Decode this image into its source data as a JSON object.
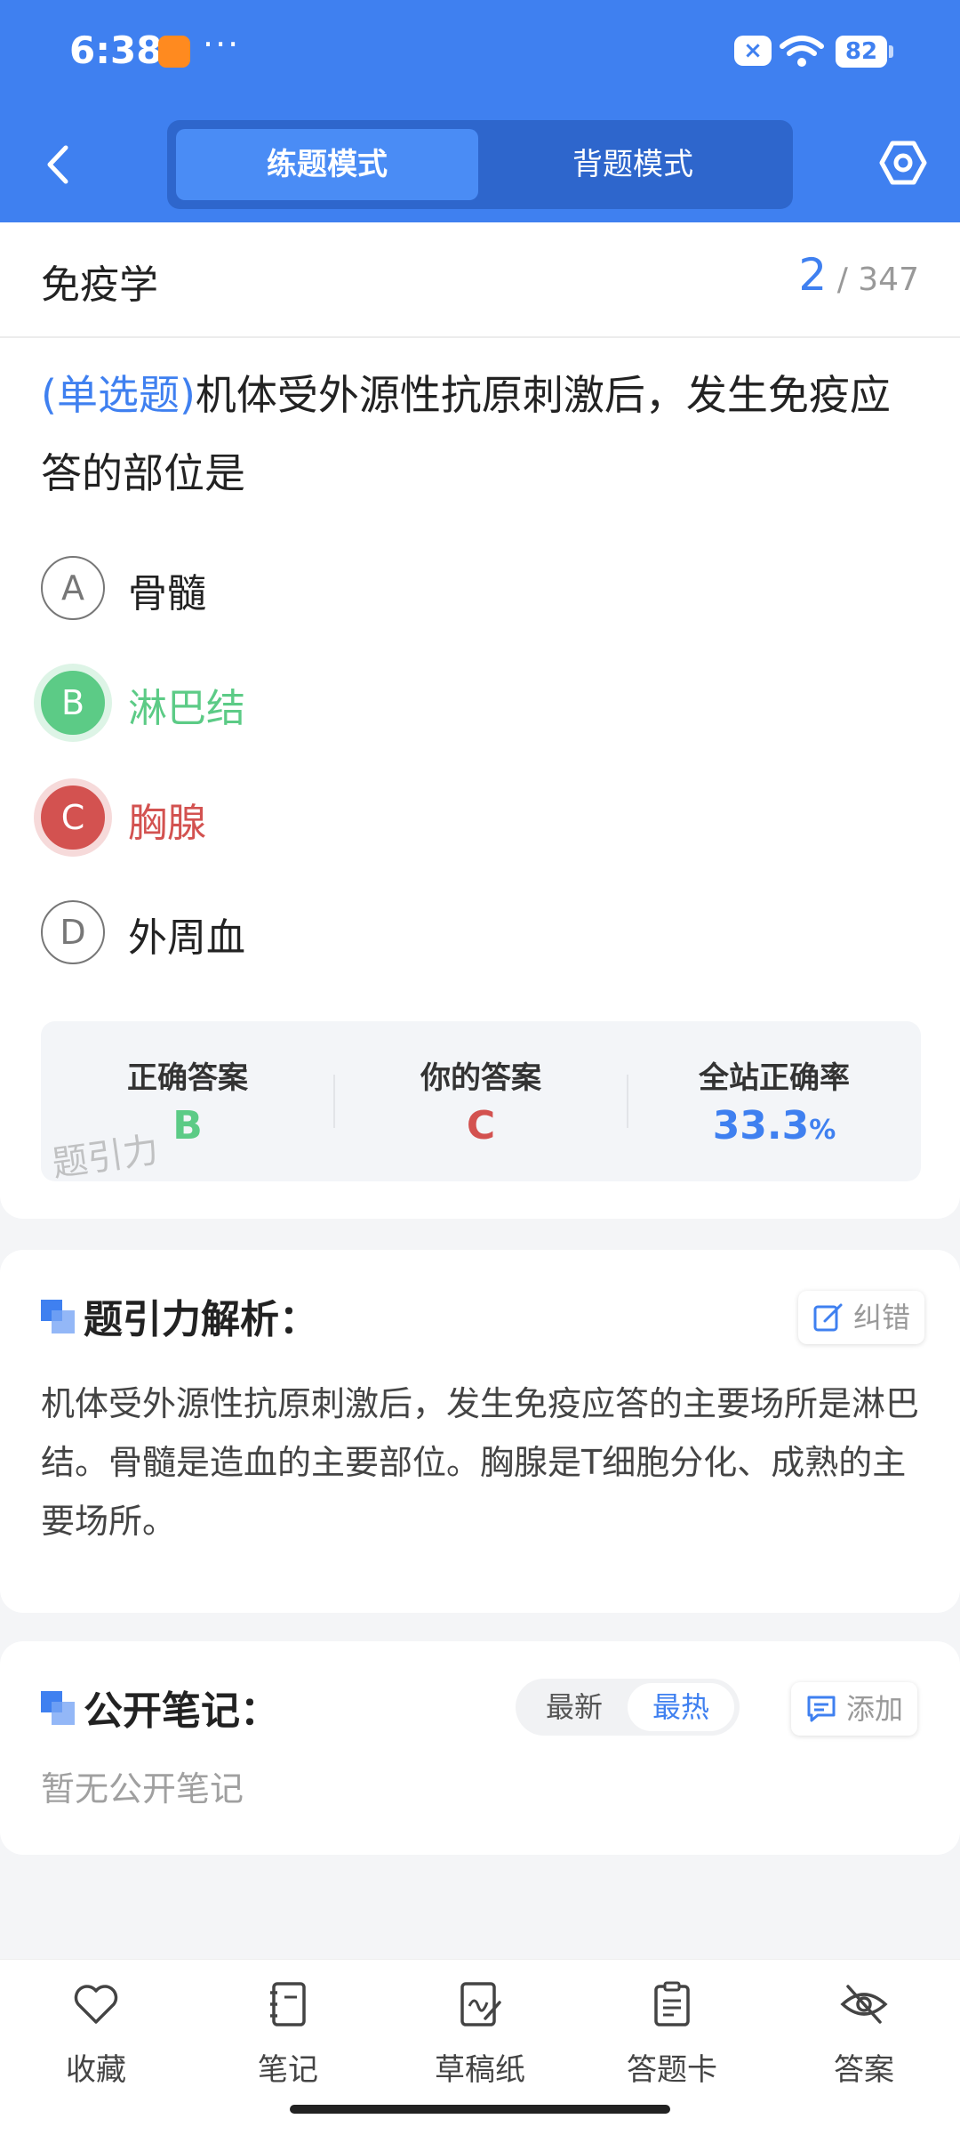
{
  "status_bar": {
    "time": "6:38",
    "more": "···",
    "battery": "82"
  },
  "header": {
    "mode_tabs": [
      {
        "label": "练题模式",
        "active": true
      },
      {
        "label": "背题模式",
        "active": false
      }
    ]
  },
  "question_card": {
    "subject": "免疫学",
    "current": "2",
    "total_sep": "/",
    "total": "347",
    "type_label": "(单选题)",
    "question_text": "机体受外源性抗原刺激后，发生免疫应答的部位是",
    "options": [
      {
        "letter": "A",
        "text": "骨髓",
        "state": "normal"
      },
      {
        "letter": "B",
        "text": "淋巴结",
        "state": "correct"
      },
      {
        "letter": "C",
        "text": "胸腺",
        "state": "wrong"
      },
      {
        "letter": "D",
        "text": "外周血",
        "state": "normal"
      }
    ],
    "summary": {
      "correct_label": "正确答案",
      "correct_value": "B",
      "yours_label": "你的答案",
      "yours_value": "C",
      "rate_label": "全站正确率",
      "rate_value": "33.3",
      "rate_unit": "%"
    },
    "watermark": "题引力"
  },
  "analysis": {
    "title": "题引力解析：",
    "report_button": "纠错",
    "text": "机体受外源性抗原刺激后，发生免疫应答的主要场所是淋巴结。骨髓是造血的主要部位。胸腺是T细胞分化、成熟的主要场所。"
  },
  "notes": {
    "title": "公开笔记：",
    "sort_latest": "最新",
    "sort_hot": "最热",
    "add_button": "添加",
    "empty_text": "暂无公开笔记"
  },
  "bottom_nav": [
    {
      "label": "收藏",
      "icon": "heart-icon"
    },
    {
      "label": "笔记",
      "icon": "notebook-icon"
    },
    {
      "label": "草稿纸",
      "icon": "draft-paper-icon"
    },
    {
      "label": "答题卡",
      "icon": "answer-sheet-icon"
    },
    {
      "label": "答案",
      "icon": "eye-off-icon"
    }
  ],
  "colors": {
    "primary": "#3F80F0",
    "correct": "#5CCB86",
    "wrong": "#D35250"
  }
}
